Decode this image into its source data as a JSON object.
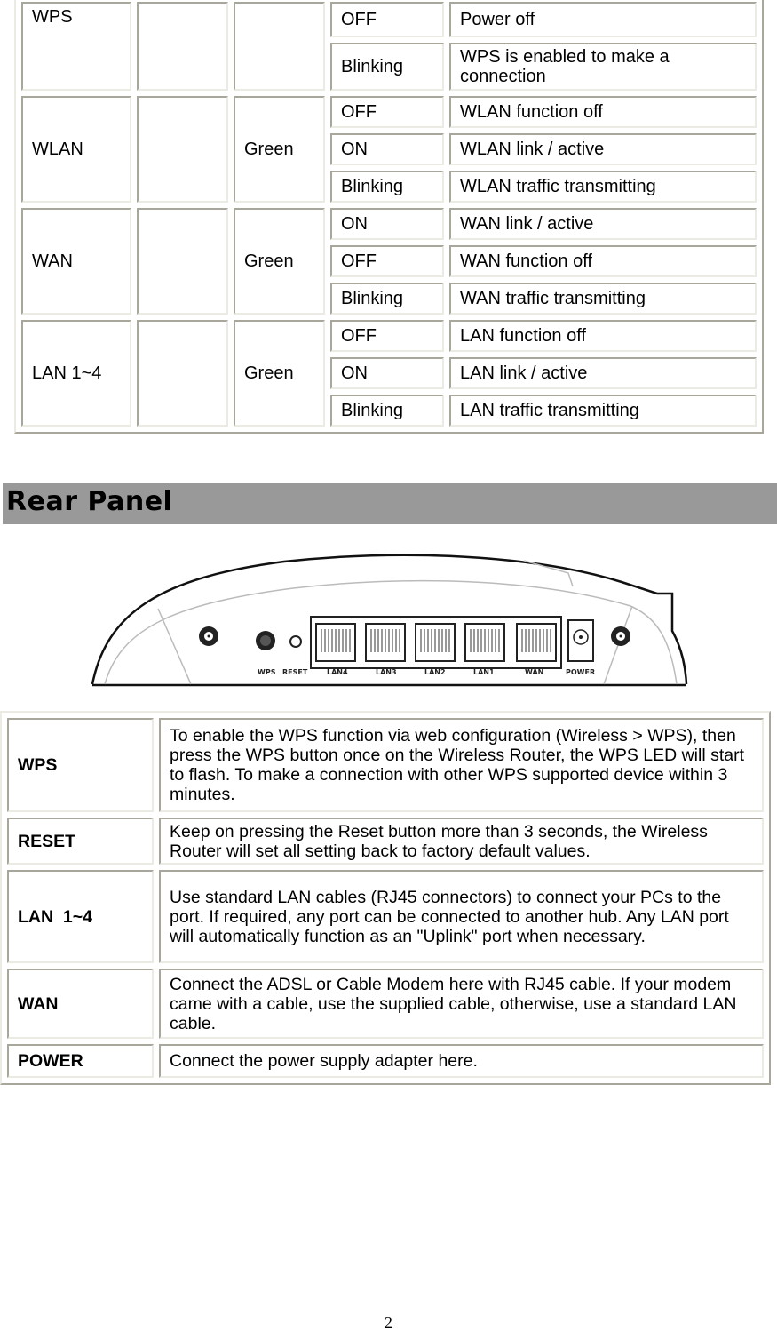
{
  "led_table": {
    "groups": [
      {
        "name": "WPS",
        "color": "",
        "states": [
          {
            "state": "OFF",
            "desc": "Power off"
          },
          {
            "state": "Blinking",
            "desc": "WPS is enabled to make a connection"
          }
        ]
      },
      {
        "name": "WLAN",
        "color": "Green",
        "states": [
          {
            "state": "OFF",
            "desc": "WLAN function off"
          },
          {
            "state": "ON",
            "desc": "WLAN link / active"
          },
          {
            "state": "Blinking",
            "desc": "WLAN traffic transmitting"
          }
        ]
      },
      {
        "name": "WAN",
        "color": "Green",
        "states": [
          {
            "state": "ON",
            "desc": "WAN link / active"
          },
          {
            "state": "OFF",
            "desc": "WAN function off"
          },
          {
            "state": "Blinking",
            "desc": "WAN traffic transmitting"
          }
        ]
      },
      {
        "name": "LAN 1~4",
        "color": "Green",
        "states": [
          {
            "state": "OFF",
            "desc": "LAN function off"
          },
          {
            "state": "ON",
            "desc": "LAN link / active"
          },
          {
            "state": "Blinking",
            "desc": "LAN traffic transmitting"
          }
        ]
      }
    ]
  },
  "section": {
    "title": "Rear Panel"
  },
  "router_image": {
    "port_labels": [
      "WPS",
      "RESET",
      "LAN4",
      "LAN3",
      "LAN2",
      "LAN1",
      "WAN",
      "POWER"
    ]
  },
  "port_table": {
    "rows": [
      {
        "label": "WPS",
        "desc": "To enable the WPS function via web configuration (Wireless > WPS), then press the WPS button once on the Wireless Router, the WPS LED will start to flash. To make a connection with other WPS supported device within 3 minutes."
      },
      {
        "label": "RESET",
        "desc": "Keep on pressing the Reset button more than 3 seconds, the Wireless  Router will set all setting back to factory default values."
      },
      {
        "label": "LAN  1~4",
        "desc": "Use standard LAN cables (RJ45 connectors) to connect your PCs to the port. If required, any port can be connected to another hub. Any LAN port will automatically function as an \"Uplink\" port when necessary."
      },
      {
        "label": "WAN",
        "desc": "Connect the ADSL or Cable Modem here with RJ45 cable. If your modem came with a cable, use the supplied cable, otherwise, use a standard LAN cable."
      },
      {
        "label": "POWER",
        "desc": "Connect the power supply adapter here."
      }
    ]
  },
  "footer": {
    "page_number": "2"
  }
}
